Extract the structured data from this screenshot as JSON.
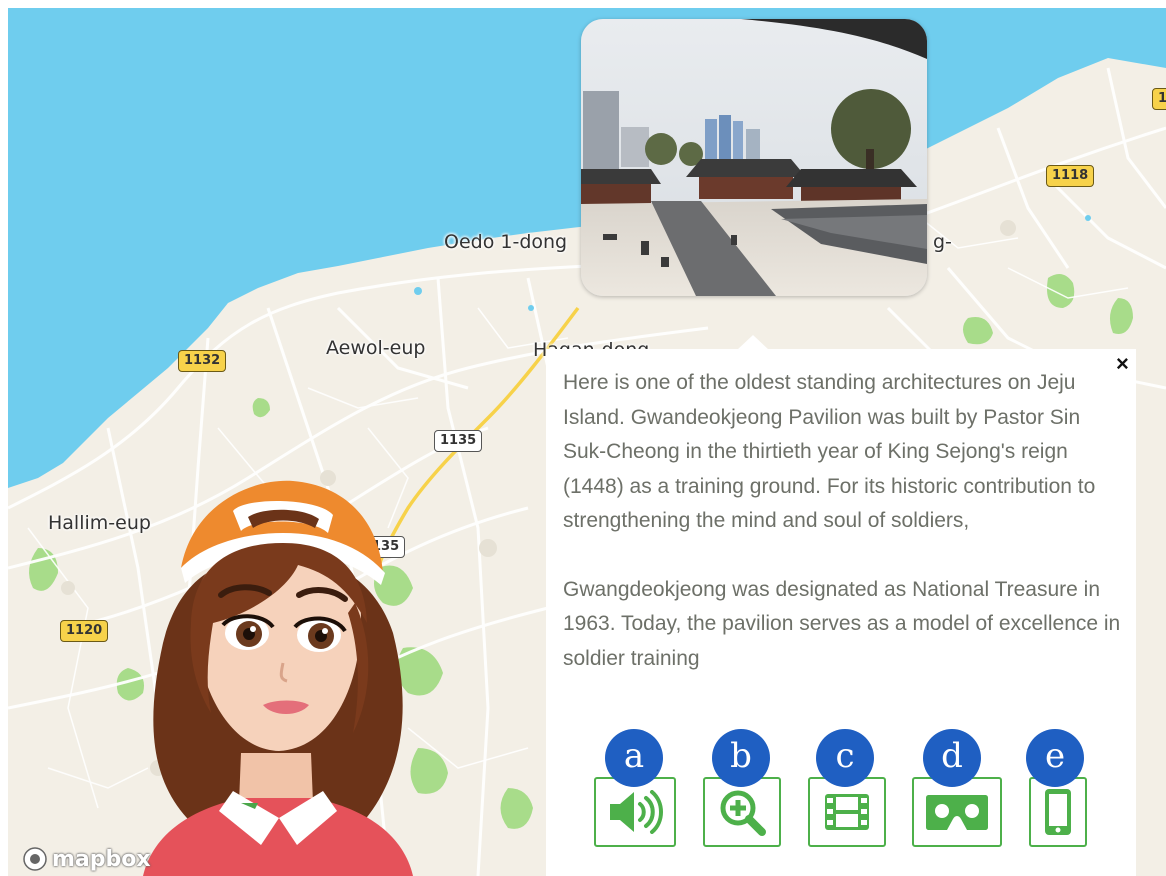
{
  "map": {
    "places": {
      "oedo": "Oedo 1-dong",
      "oedo_right_fragment": "g-",
      "aewol": "Aewol-eup",
      "hasan": "Hagan-dong",
      "hallim": "Hallim-eup"
    },
    "road_shields": {
      "r1132": "1132",
      "r1135": "1135",
      "r1135_lower": "135",
      "r1120": "1120",
      "r1118": "1118",
      "r_edge": "1"
    },
    "attribution": "mapbox",
    "colors": {
      "sea": "#6fcdee",
      "land": "#f3efe6",
      "park": "#a8dc8a",
      "road_primary": "#f7d24a"
    }
  },
  "popup": {
    "close_label": "×",
    "paragraph_1": "Here is one of the oldest standing architectures on Jeju Island. Gwandeokjeong Pavilion was built by Pastor Sin Suk-Cheong in the thirtieth year of King Sejong's reign (1448) as a training ground. For its historic contribution to strengthening the mind and soul of soldiers,",
    "paragraph_2": "Gwangdeokjeong was designated as National Treasure in 1963. Today, the pavilion serves as a model of excellence in soldier training",
    "actions": [
      {
        "badge": "a",
        "icon": "speaker-icon"
      },
      {
        "badge": "b",
        "icon": "zoom-in-icon"
      },
      {
        "badge": "c",
        "icon": "film-icon"
      },
      {
        "badge": "d",
        "icon": "vr-headset-icon"
      },
      {
        "badge": "e",
        "icon": "smartphone-icon"
      }
    ],
    "accent_color": "#4db04a",
    "badge_color": "#1f5fc2"
  }
}
